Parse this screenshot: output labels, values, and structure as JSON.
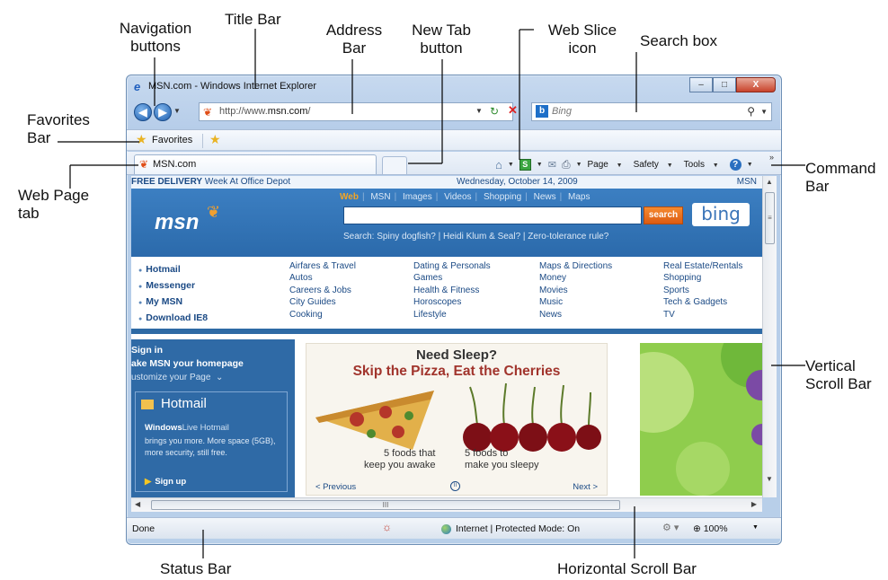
{
  "callouts": {
    "navigation_buttons": [
      "Navigation",
      "buttons"
    ],
    "title_bar": "Title Bar",
    "address_bar": [
      "Address",
      "Bar"
    ],
    "new_tab_button": [
      "New Tab",
      "button"
    ],
    "web_slice_icon": [
      "Web Slice",
      "icon"
    ],
    "search_box": "Search box",
    "favorites_bar": [
      "Favorites",
      "Bar"
    ],
    "web_page_tab": [
      "Web Page",
      "tab"
    ],
    "command_bar": [
      "Command",
      "Bar"
    ],
    "vertical_scroll_bar": [
      "Vertical",
      "Scroll Bar"
    ],
    "status_bar": "Status Bar",
    "horizontal_scroll_bar": "Horizontal Scroll Bar"
  },
  "window": {
    "title": "MSN.com - Windows Internet Explorer",
    "buttons": {
      "minimize": "–",
      "maximize": "□",
      "close": "X"
    }
  },
  "address": {
    "prefix": "http://www.",
    "domain": "msn.com",
    "suffix": "/"
  },
  "search": {
    "placeholder": "Bing",
    "brand_letter": "b"
  },
  "favorites": {
    "label": "Favorites"
  },
  "tab": {
    "title": "MSN.com"
  },
  "command_bar": {
    "page": "Page",
    "safety": "Safety",
    "tools": "Tools",
    "help_glyph": "?",
    "slice_glyph": "S",
    "more": "»"
  },
  "page": {
    "promo_bold": "FREE DELIVERY",
    "promo_text": " Week At Office Depot",
    "date": "Wednesday, October 14, 2009",
    "msn_right": "MSN",
    "logo": "msn",
    "search_tabs": [
      "Web",
      "MSN",
      "Images",
      "Videos",
      "Shopping",
      "News",
      "Maps"
    ],
    "search_button": "search",
    "bing_logo": "bing",
    "trending": "Search:  Spiny dogfish?  |  Heidi Klum & Seal?  |  Zero-tolerance rule?",
    "side_links": [
      "Hotmail",
      "Messenger",
      "My MSN",
      "Download IE8"
    ],
    "link_columns": [
      [
        "Airfares & Travel",
        "Autos",
        "Careers & Jobs",
        "City Guides",
        "Cooking"
      ],
      [
        "Dating & Personals",
        "Games",
        "Health & Fitness",
        "Horoscopes",
        "Lifestyle"
      ],
      [
        "Maps & Directions",
        "Money",
        "Movies",
        "Music",
        "News"
      ],
      [
        "Real Estate/Rentals",
        "Shopping",
        "Sports",
        "Tech & Gadgets",
        "TV"
      ]
    ],
    "sign_in": "Sign in",
    "make_home": "ake MSN your homepage",
    "customize": "ustomize your Page",
    "hotmail_title": "Hotmail",
    "windows_live": "Windows",
    "live_hotmail": "Live Hotmail",
    "hotmail_desc": "brings you more. More space (5GB), more security, still free.",
    "sign_up": "Sign up",
    "ad_headline": "Need Sleep?",
    "ad_subhead": "Skip the Pizza, Eat the Cherries",
    "ad_caption_left": [
      "5 foods that",
      "keep you awake"
    ],
    "ad_caption_right": [
      "5 foods to",
      "make you sleepy"
    ],
    "ad_prev": "< Previous",
    "ad_next": "Next >"
  },
  "status": {
    "left": "Done",
    "zone": "Internet | Protected Mode: On",
    "zoom": "100%"
  },
  "colors": {
    "window_frame": "#b6cde9",
    "msn_blue": "#2b6aab",
    "search_orange": "#dc5b12",
    "link_blue": "#1b4a85",
    "ad_red": "#a1342c",
    "green_panel": "#8fcd4d"
  }
}
